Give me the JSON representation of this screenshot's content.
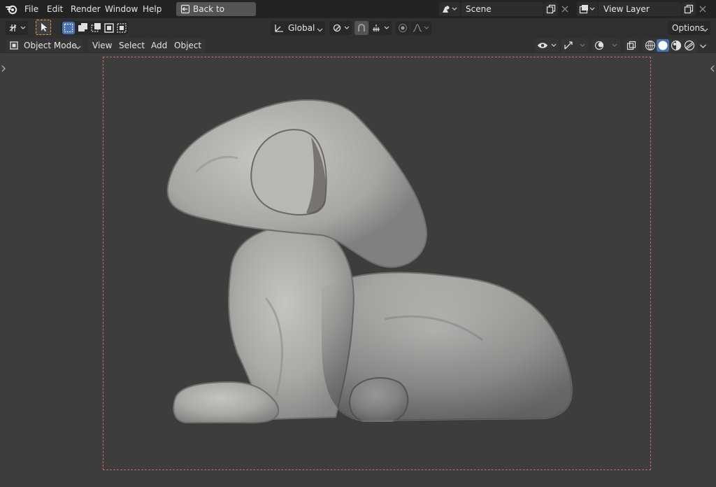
{
  "menubar": {
    "items": [
      "File",
      "Edit",
      "Render",
      "Window",
      "Help"
    ],
    "back_button": "Back to Previous",
    "scene_name": "Scene",
    "view_layer_name": "View Layer"
  },
  "toolbar": {
    "orientation": "Global",
    "options_label": "Options"
  },
  "header": {
    "mode": "Object Mode",
    "menus": [
      "View",
      "Select",
      "Add",
      "Object"
    ]
  },
  "colors": {
    "accent_blue": "#4772b3",
    "active_tool_orange": "#e89b3a",
    "camera_frame": "#c96a6a",
    "background": "#3d3d3d"
  },
  "viewport": {
    "object": "sculpted-dog-mesh"
  }
}
